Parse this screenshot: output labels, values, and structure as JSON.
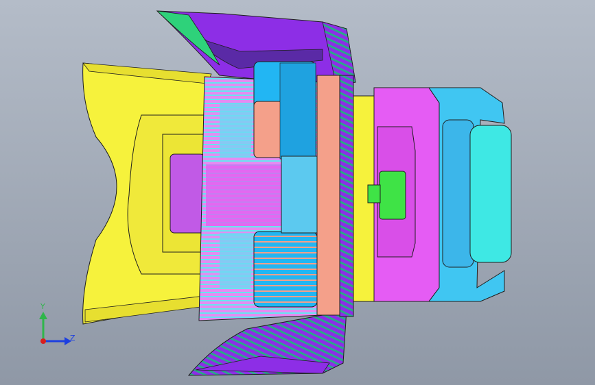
{
  "viewport": {
    "background_top": "#b4bcc8",
    "background_bottom": "#8f98a6"
  },
  "triad": {
    "y_label": "Y",
    "z_label": "Z",
    "y_color": "#2fb64a",
    "z_color": "#1c3fe0",
    "origin_color": "#d81e1e"
  },
  "colors": {
    "yellow_part": "#f6f23c",
    "purple_housing": "#8d2ee6",
    "magenta_cover": "#e55cf4",
    "blue_disc": "#22b6f3",
    "salmon_ring": "#f4a08a",
    "cyan_cover": "#40c6f2",
    "green_clip": "#3fe346",
    "outline": "#1e1e1e"
  }
}
